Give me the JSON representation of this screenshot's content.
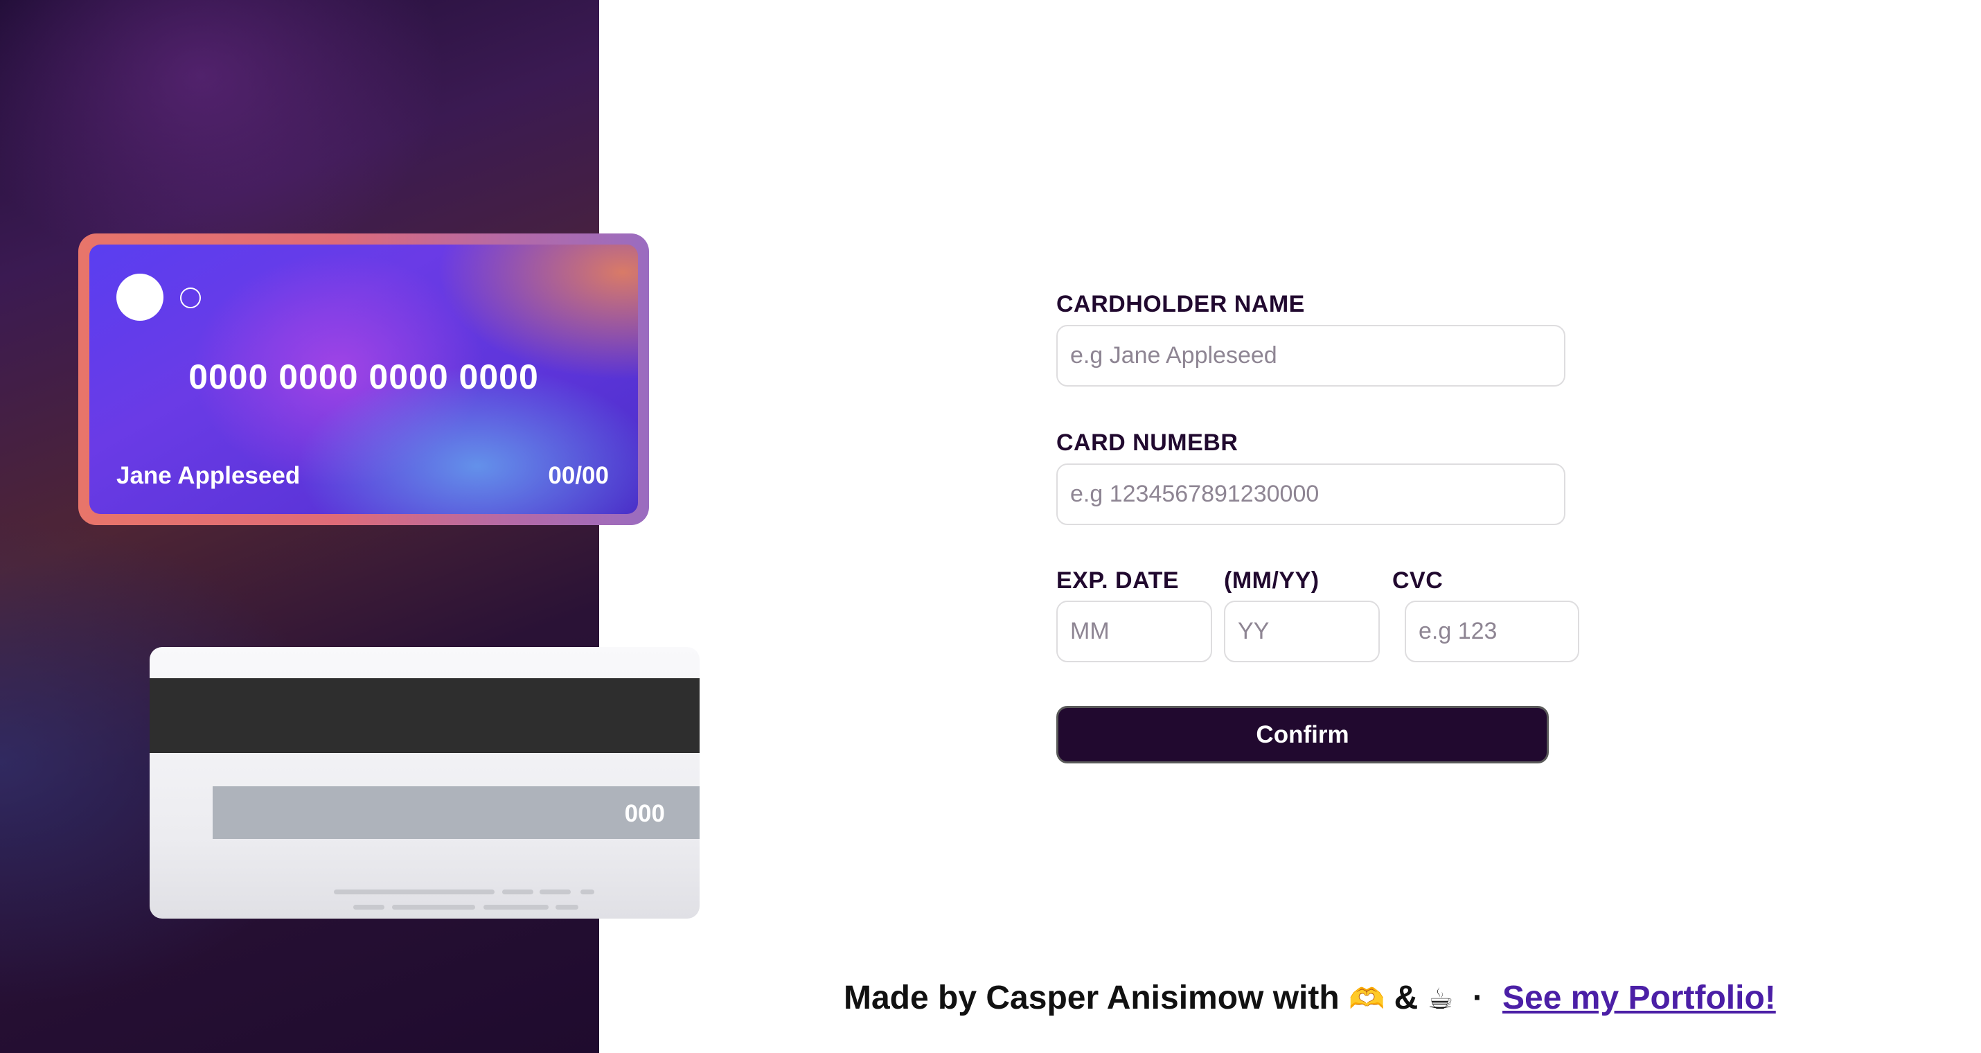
{
  "card_front": {
    "number": "0000 0000 0000 0000",
    "name": "Jane Appleseed",
    "expiry": "00/00"
  },
  "card_back": {
    "cvc": "000"
  },
  "form": {
    "cardholder_label": "CARDHOLDER NAME",
    "cardholder_placeholder": "e.g Jane Appleseed",
    "number_label": "CARD NUMEBR",
    "number_placeholder": "e.g 1234567891230000",
    "exp_label": "EXP. DATE",
    "exp_format_label": "(MM/YY)",
    "cvc_label": "CVC",
    "month_placeholder": "MM",
    "year_placeholder": "YY",
    "cvc_placeholder": "e.g 123",
    "confirm_label": "Confirm"
  },
  "footer": {
    "text": "Made by Casper Anisimow with",
    "emoji_hands": "🫶",
    "amp": "&",
    "emoji_coffee": "☕",
    "separator": "·",
    "link_label": "See my Portfolio!"
  },
  "colors": {
    "dark_violet": "#21092f",
    "link": "#4b1fa6",
    "border": "#dedddf"
  }
}
